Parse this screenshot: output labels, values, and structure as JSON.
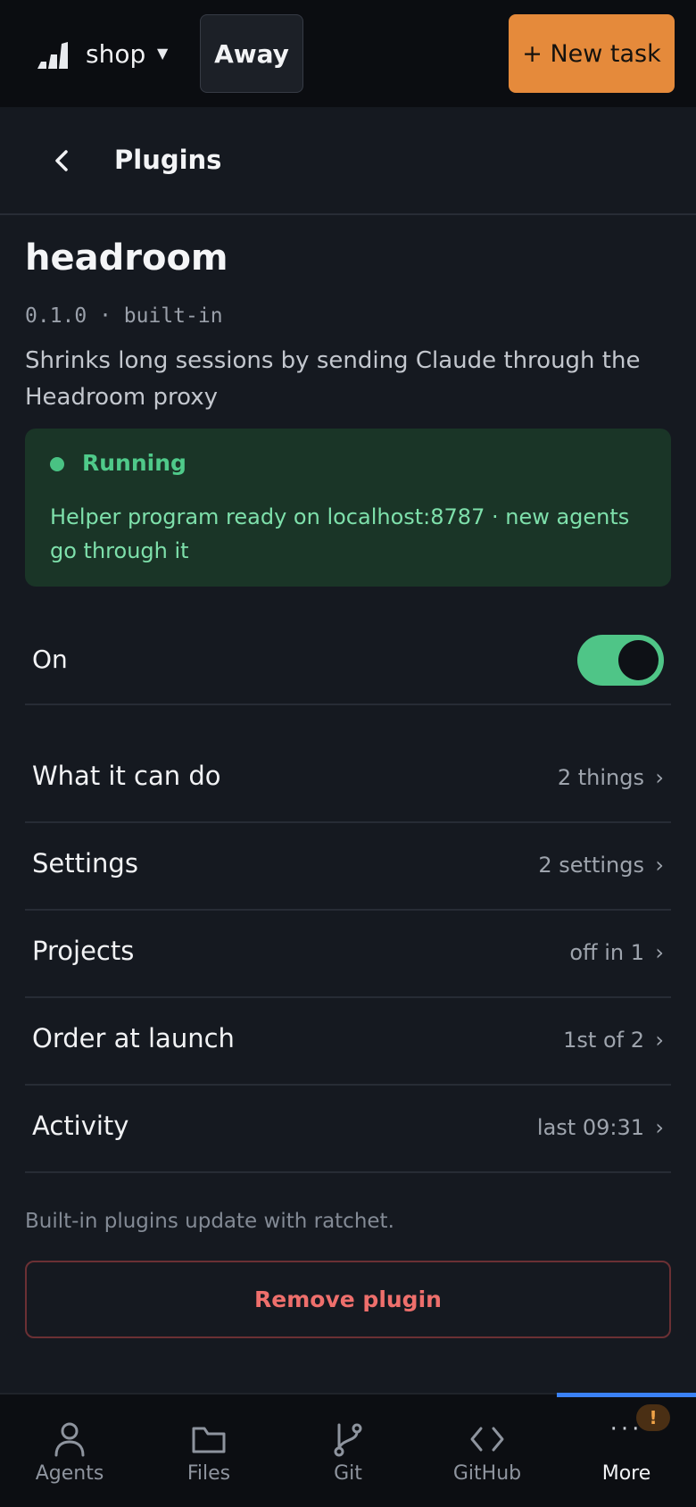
{
  "topbar": {
    "project": "shop",
    "mode_button": "Away",
    "new_task_button": "+ New task"
  },
  "subheader": {
    "title": "Plugins"
  },
  "plugin": {
    "name": "headroom",
    "meta": "0.1.0 · built-in",
    "description": "Shrinks long sessions by sending Claude through the Headroom proxy"
  },
  "status": {
    "label": "Running",
    "detail": "Helper program ready on localhost:8787 · new agents go through it",
    "color": "#4fca8a"
  },
  "toggle": {
    "label": "On",
    "state": true
  },
  "menu": [
    {
      "label": "What it can do",
      "value": "2 things"
    },
    {
      "label": "Settings",
      "value": "2 settings"
    },
    {
      "label": "Projects",
      "value": "off in 1"
    },
    {
      "label": "Order at launch",
      "value": "1st of 2"
    },
    {
      "label": "Activity",
      "value": "last 09:31"
    }
  ],
  "footnote": "Built-in plugins update with ratchet.",
  "remove_button": "Remove plugin",
  "bottom_nav": {
    "items": [
      {
        "label": "Agents",
        "icon": "person-icon"
      },
      {
        "label": "Files",
        "icon": "folder-icon"
      },
      {
        "label": "Git",
        "icon": "git-branch-icon"
      },
      {
        "label": "GitHub",
        "icon": "code-brackets-icon"
      },
      {
        "label": "More",
        "icon": "more-dots-icon"
      }
    ],
    "active": "More",
    "badge": "!",
    "accent": "#3b82f6"
  }
}
